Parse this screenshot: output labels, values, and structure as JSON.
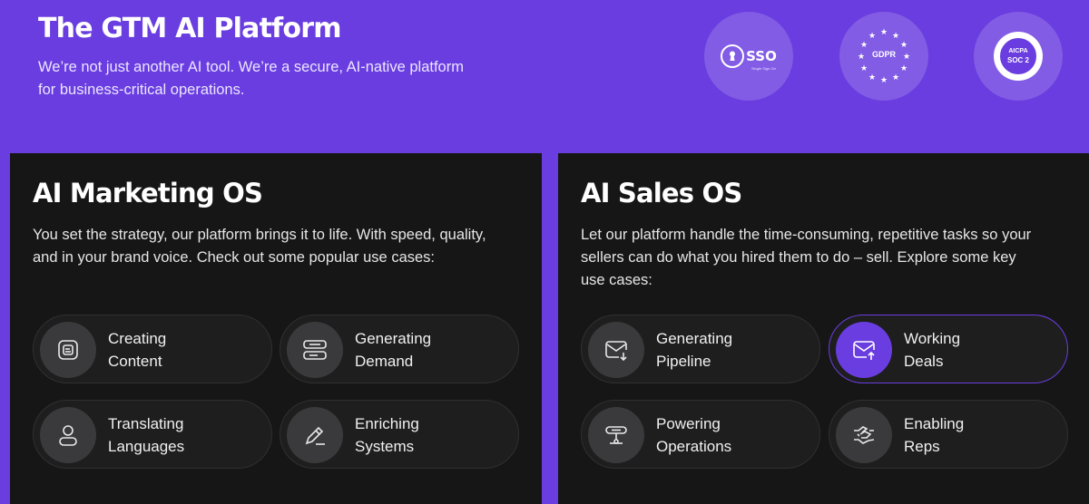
{
  "hero": {
    "title": "The GTM AI Platform",
    "subtitle": "We’re not just another AI tool. We’re a secure, AI-native platform for business-critical operations."
  },
  "badges": {
    "sso": {
      "label": "SSO",
      "sub": "Single Sign-On"
    },
    "gdpr": {
      "label": "GDPR"
    },
    "soc": {
      "org": "AICPA",
      "label": "SOC 2"
    }
  },
  "marketing": {
    "title": "AI Marketing OS",
    "description": "You set the strategy, our platform brings it to life. With speed, quality, and in your brand voice. Check out some popular use cases:",
    "cards": [
      {
        "line1": "Creating",
        "line2": "Content",
        "icon": "document-icon"
      },
      {
        "line1": "Generating",
        "line2": "Demand",
        "icon": "stacked-bars-icon"
      },
      {
        "line1": "Translating",
        "line2": "Languages",
        "icon": "person-icon"
      },
      {
        "line1": "Enriching",
        "line2": "Systems",
        "icon": "pencil-icon"
      }
    ]
  },
  "sales": {
    "title": "AI Sales OS",
    "description": "Let our platform handle the time-consuming, repetitive tasks so your sellers can do what you hired them to do – sell. Explore some key use cases:",
    "cards": [
      {
        "line1": "Generating",
        "line2": "Pipeline",
        "icon": "mail-down-icon"
      },
      {
        "line1": "Working",
        "line2": "Deals",
        "icon": "mail-up-icon",
        "active": true
      },
      {
        "line1": "Powering",
        "line2": "Operations",
        "icon": "flow-icon"
      },
      {
        "line1": "Enabling",
        "line2": "Reps",
        "icon": "handshake-icon"
      }
    ]
  },
  "colors": {
    "accent": "#6a3de0",
    "panel": "#161616",
    "card": "#1e1e1e",
    "icon_bg": "#3a3a3c"
  }
}
